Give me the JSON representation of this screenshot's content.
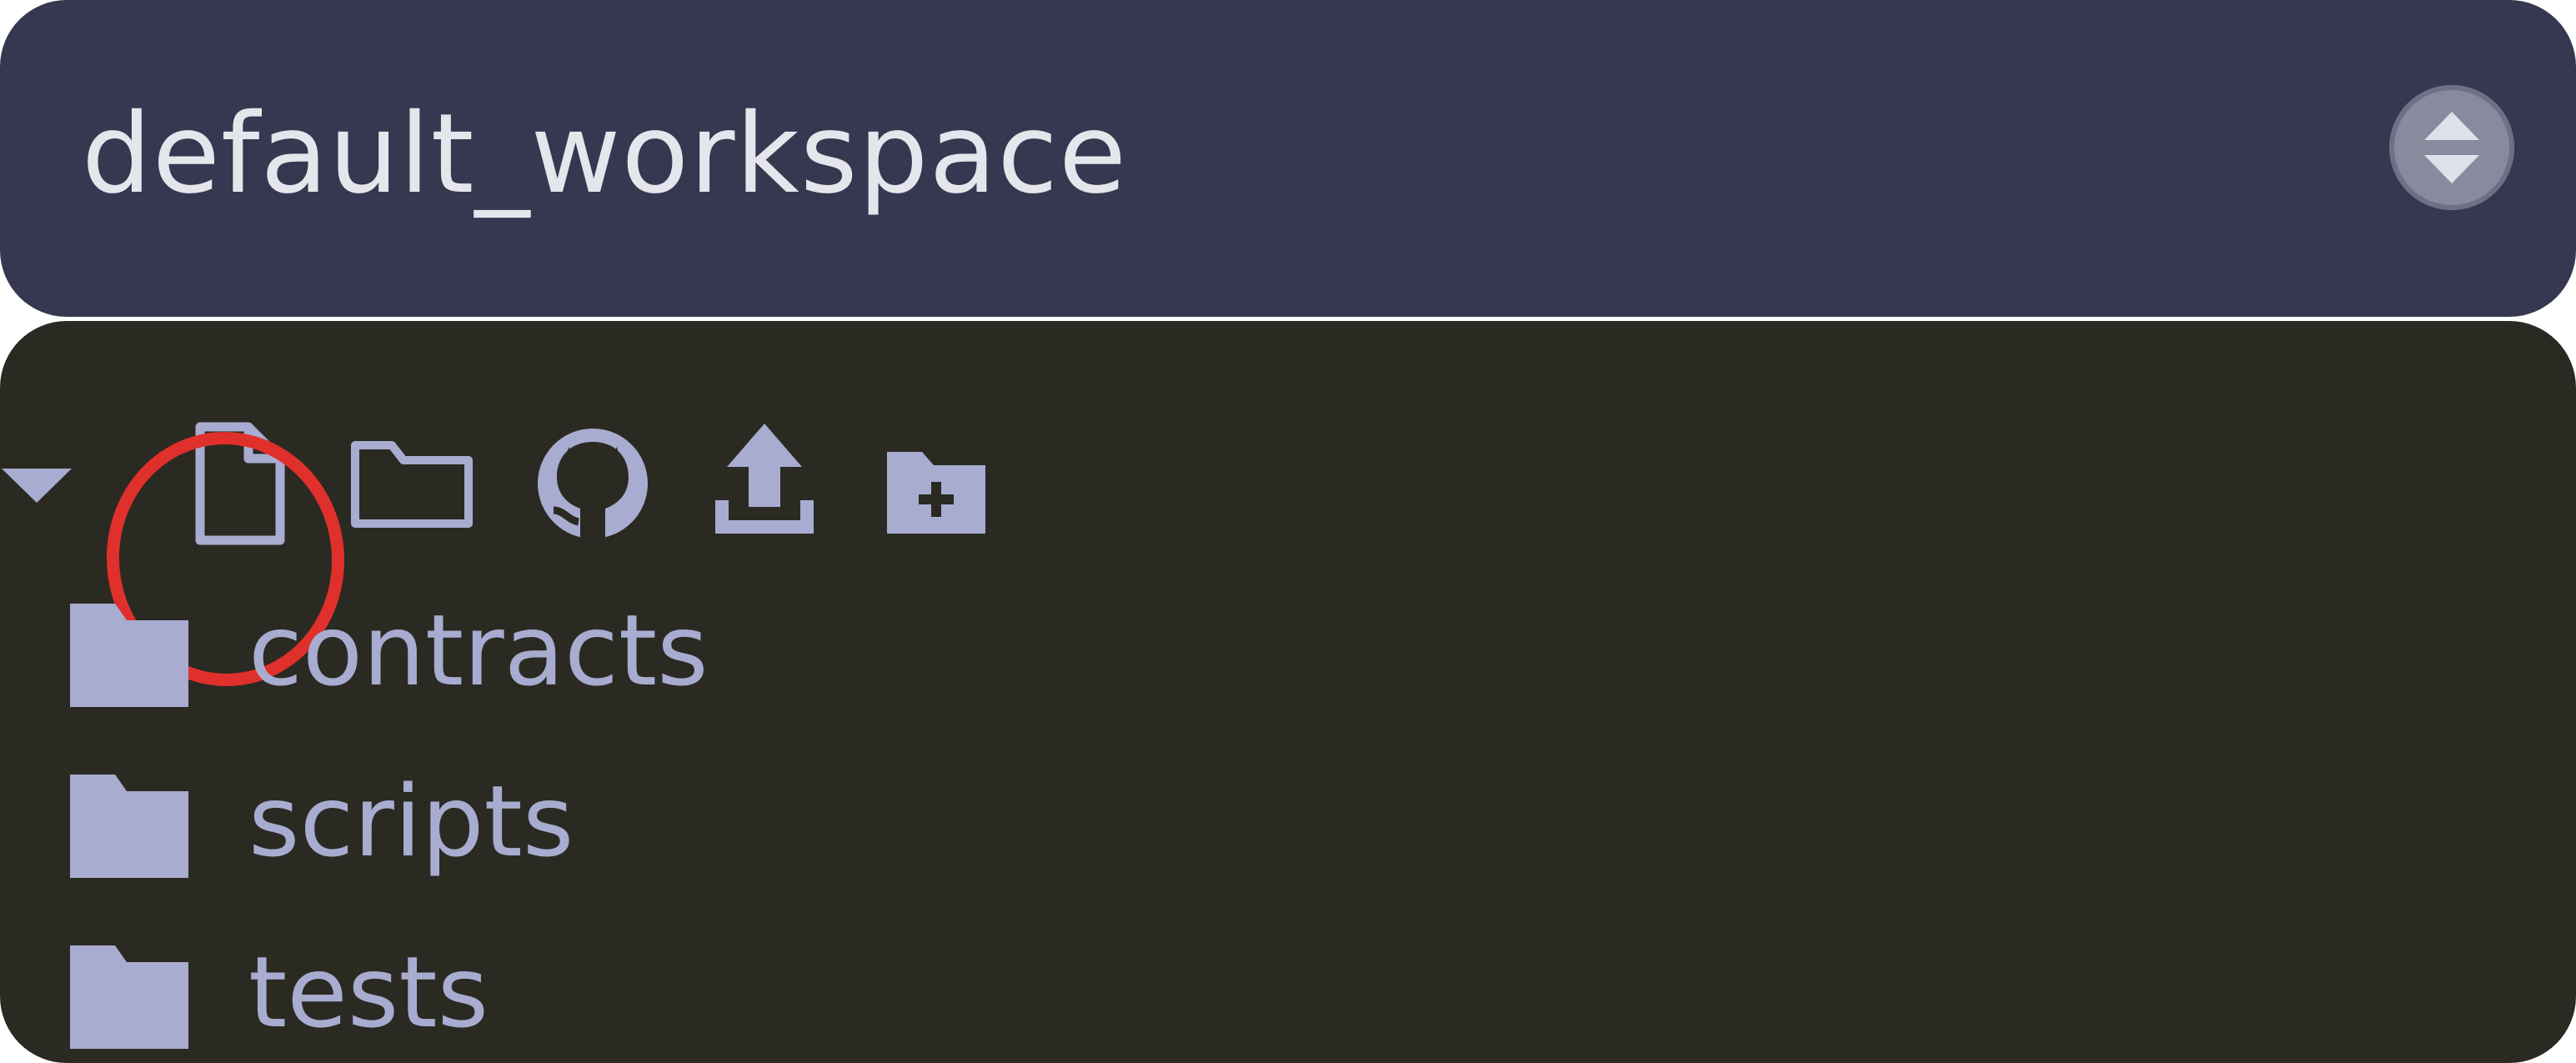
{
  "workspace": {
    "name": "default_workspace"
  },
  "toolbar": {
    "icons": [
      "collapse-caret-icon",
      "new-file-icon",
      "new-folder-icon",
      "github-icon",
      "upload-icon",
      "folder-plus-icon"
    ],
    "highlighted": "new-file-icon",
    "highlight_color": "#e0302b"
  },
  "tree": {
    "items": [
      {
        "label": "contracts",
        "icon": "folder-icon"
      },
      {
        "label": "scripts",
        "icon": "folder-icon"
      },
      {
        "label": "tests",
        "icon": "folder-icon"
      }
    ]
  },
  "colors": {
    "workspace_bg": "#363750",
    "explorer_bg": "#2a2a22",
    "icon": "#a8acd0",
    "text": "#e4e6ec"
  }
}
